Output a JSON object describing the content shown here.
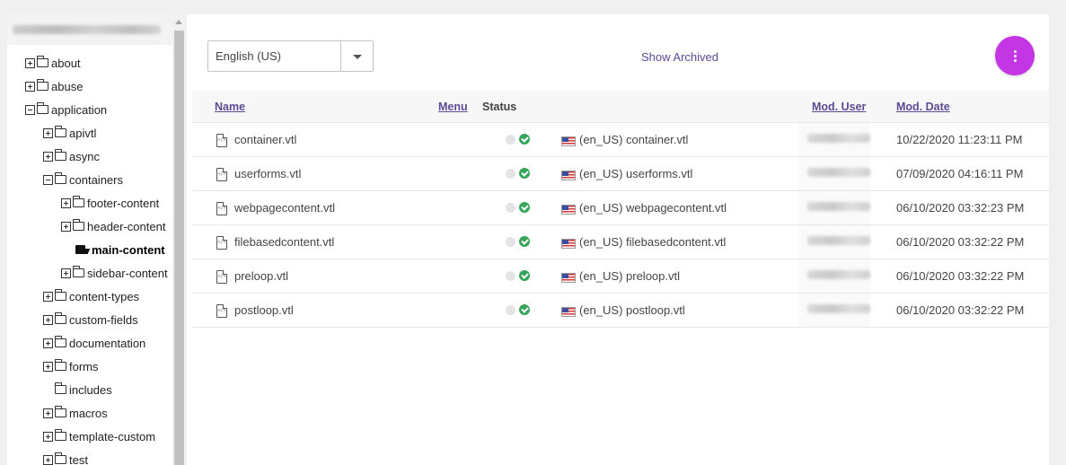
{
  "sidebar": {
    "host_label": "",
    "tree": [
      {
        "label": "about",
        "toggle": "plus",
        "depth": 0
      },
      {
        "label": "abuse",
        "toggle": "plus",
        "depth": 0
      },
      {
        "label": "application",
        "toggle": "minus",
        "depth": 0
      },
      {
        "label": "apivtl",
        "toggle": "plus",
        "depth": 1
      },
      {
        "label": "async",
        "toggle": "plus",
        "depth": 1
      },
      {
        "label": "containers",
        "toggle": "minus",
        "depth": 1
      },
      {
        "label": "footer-content",
        "toggle": "plus",
        "depth": 2
      },
      {
        "label": "header-content",
        "toggle": "plus",
        "depth": 2
      },
      {
        "label": "main-content",
        "toggle": "none",
        "depth": 2,
        "active": true
      },
      {
        "label": "sidebar-content",
        "toggle": "plus",
        "depth": 2
      },
      {
        "label": "content-types",
        "toggle": "plus",
        "depth": 1
      },
      {
        "label": "custom-fields",
        "toggle": "plus",
        "depth": 1
      },
      {
        "label": "documentation",
        "toggle": "plus",
        "depth": 1
      },
      {
        "label": "forms",
        "toggle": "plus",
        "depth": 1
      },
      {
        "label": "includes",
        "toggle": "none",
        "depth": 1
      },
      {
        "label": "macros",
        "toggle": "plus",
        "depth": 1
      },
      {
        "label": "template-custom",
        "toggle": "plus",
        "depth": 1
      },
      {
        "label": "test",
        "toggle": "plus",
        "depth": 1
      }
    ]
  },
  "toolbar": {
    "language": "English (US)",
    "show_archived": "Show Archived",
    "actions_icon": "vertical-dots-icon",
    "accent_color": "#c435e3"
  },
  "table": {
    "headers": {
      "name": "Name",
      "menu": "Menu",
      "status": "Status",
      "mod_user": "Mod. User",
      "mod_date": "Mod. Date"
    },
    "rows": [
      {
        "name": "container.vtl",
        "lang": "(en_US) container.vtl",
        "mod_date": "10/22/2020 11:23:11 PM"
      },
      {
        "name": "userforms.vtl",
        "lang": "(en_US) userforms.vtl",
        "mod_date": "07/09/2020 04:16:11 PM"
      },
      {
        "name": "webpagecontent.vtl",
        "lang": "(en_US) webpagecontent.vtl",
        "mod_date": "06/10/2020 03:32:23 PM"
      },
      {
        "name": "filebasedcontent.vtl",
        "lang": "(en_US) filebasedcontent.vtl",
        "mod_date": "06/10/2020 03:32:22 PM"
      },
      {
        "name": "preloop.vtl",
        "lang": "(en_US) preloop.vtl",
        "mod_date": "06/10/2020 03:32:22 PM"
      },
      {
        "name": "postloop.vtl",
        "lang": "(en_US) postloop.vtl",
        "mod_date": "06/10/2020 03:32:22 PM"
      }
    ]
  }
}
